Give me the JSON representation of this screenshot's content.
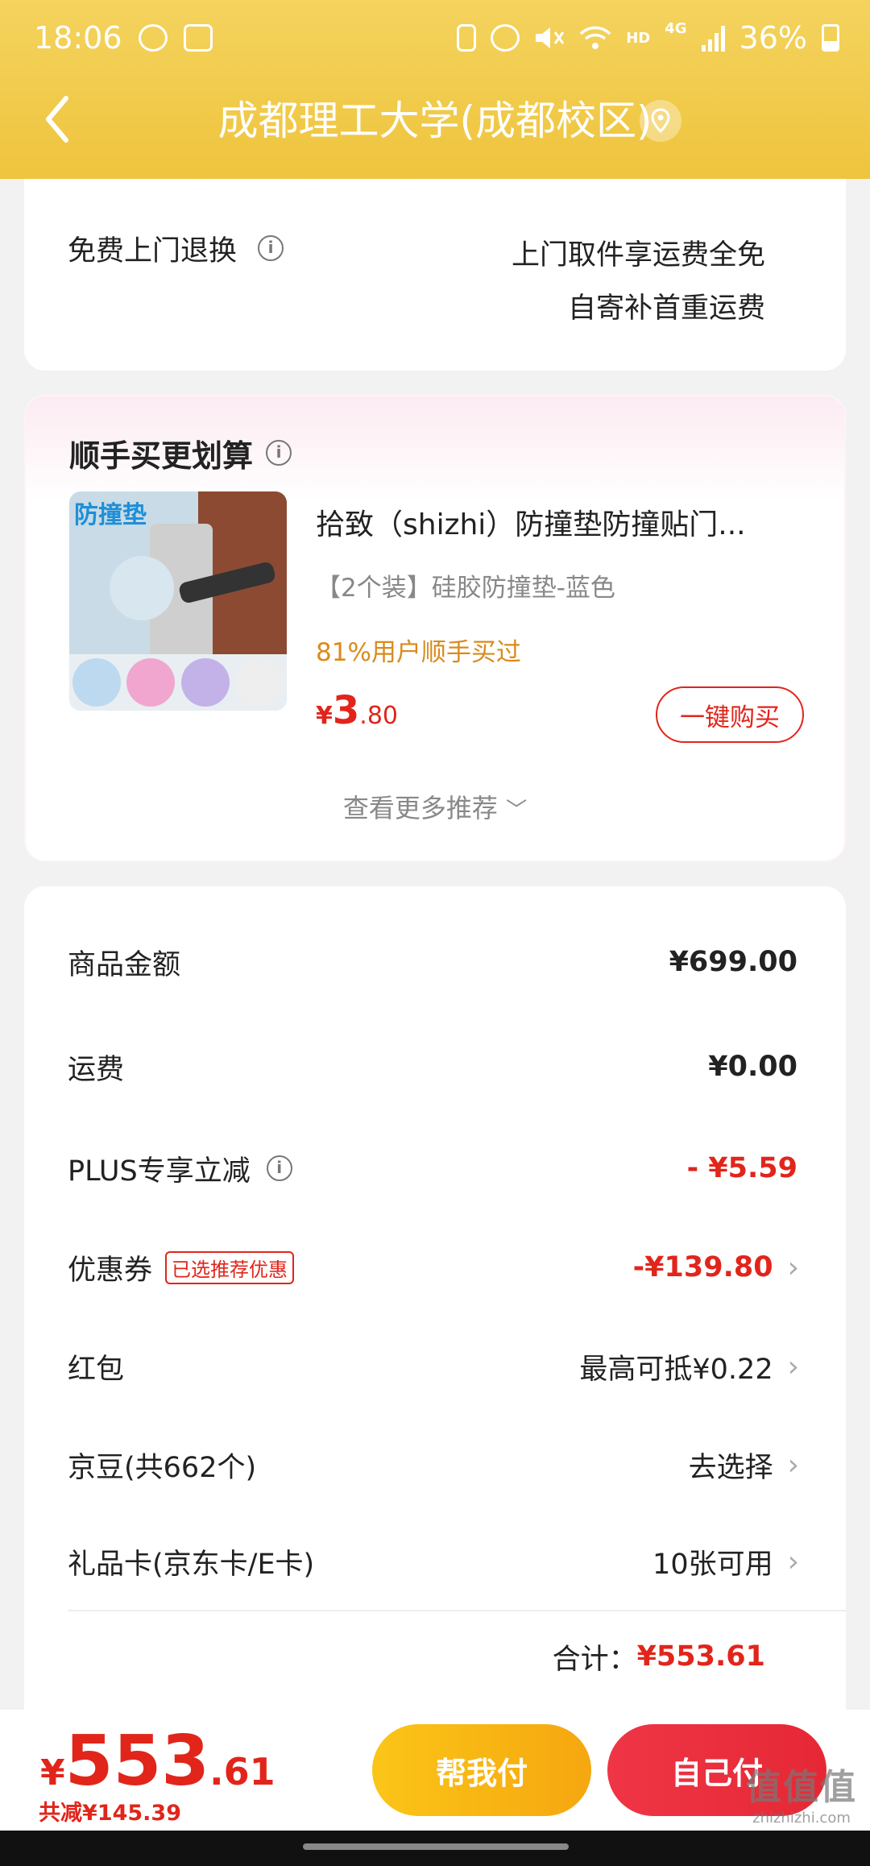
{
  "status_bar": {
    "time": "18:06",
    "network": "4G",
    "hd": "HD",
    "battery": "36%"
  },
  "header": {
    "address": "成都理工大学(成都校区)"
  },
  "returns": {
    "label": "免费上门退换",
    "line1": "上门取件享运费全免",
    "line2": "自寄补首重运费"
  },
  "recommend": {
    "title": "顺手买更划算",
    "product": {
      "name": "拾致（shizhi）防撞垫防撞贴门...",
      "spec": "【2个装】硅胶防撞垫-蓝色",
      "bought": "81%用户顺手买过",
      "price_symbol": "¥",
      "price_int": "3",
      "price_dec": ".80",
      "buy_label": "一键购买",
      "image_title": "防撞垫"
    },
    "more_label": "查看更多推荐"
  },
  "summary": {
    "goods_label": "商品金额",
    "goods_value": "¥699.00",
    "freight_label": "运费",
    "freight_value": "¥0.00",
    "plus_label": "PLUS专享立减",
    "plus_value": "- ¥5.59",
    "coupon_label": "优惠券",
    "coupon_tag": "已选推荐优惠",
    "coupon_value": "-¥139.80",
    "redpacket_label": "红包",
    "redpacket_value": "最高可抵¥0.22",
    "jingdou_label": "京豆(共662个)",
    "jingdou_value": "去选择",
    "giftcard_label": "礼品卡(京东卡/E卡)",
    "giftcard_value": "10张可用",
    "total_label": "合计：",
    "total_value": "¥553.61"
  },
  "footer": {
    "price_symbol": "¥",
    "price_int": "553",
    "price_dec": ".61",
    "discount": "共减¥145.39",
    "help_pay": "帮我付",
    "self_pay": "自己付"
  },
  "watermark": {
    "text": "值值值",
    "url": "zhizhizhi.com"
  },
  "colors": {
    "header": "#f4d35e",
    "accent_red": "#e1251b",
    "help_pay": "#f8b418",
    "self_pay": "#ea2e3c"
  }
}
